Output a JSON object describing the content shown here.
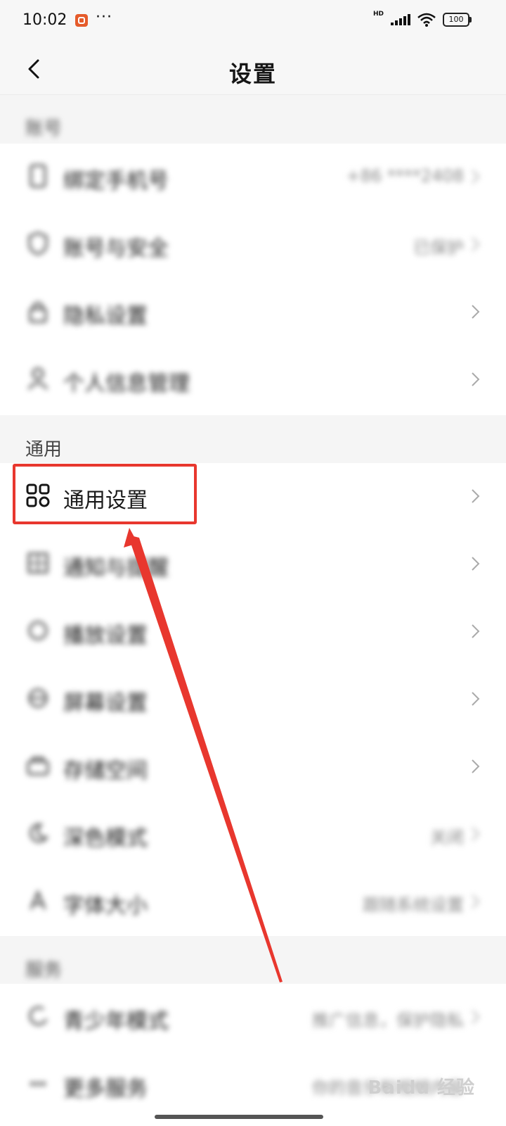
{
  "status_bar": {
    "time": "10:02",
    "more": "···",
    "hd": "HD",
    "battery": "100"
  },
  "header": {
    "title": "设置"
  },
  "sections": [
    {
      "label": "账号",
      "items": [
        {
          "label": "绑定手机号",
          "value": "+86 ****2408",
          "icon": "phone-icon"
        },
        {
          "label": "账号与安全",
          "value": "已保护",
          "icon": "shield-icon"
        },
        {
          "label": "隐私设置",
          "value": "",
          "icon": "lock-icon"
        },
        {
          "label": "个人信息管理",
          "value": "",
          "icon": "person-icon"
        }
      ]
    },
    {
      "label": "通用",
      "items": [
        {
          "label": "通用设置",
          "value": "",
          "icon": "grid-apps-icon"
        },
        {
          "label": "通知与提醒",
          "value": "",
          "icon": "notification-icon"
        },
        {
          "label": "播放设置",
          "value": "",
          "icon": "play-settings-icon"
        },
        {
          "label": "屏幕设置",
          "value": "",
          "icon": "screen-icon"
        },
        {
          "label": "存储空间",
          "value": "",
          "icon": "storage-icon"
        },
        {
          "label": "深色模式",
          "value": "关闭",
          "icon": "dark-mode-icon"
        },
        {
          "label": "字体大小",
          "value": "跟随系统设置",
          "icon": "font-size-icon"
        }
      ]
    },
    {
      "label": "服务",
      "items": [
        {
          "label": "青少年模式",
          "value": "推广信息，保护隐私",
          "icon": "leaf-icon"
        },
        {
          "label": "更多服务",
          "value": "你的音乐和视频内容",
          "icon": "more-services-icon"
        }
      ]
    }
  ],
  "watermark": "Baidu 经验",
  "colors": {
    "highlight": "#e8372e",
    "background": "#f5f5f5"
  }
}
